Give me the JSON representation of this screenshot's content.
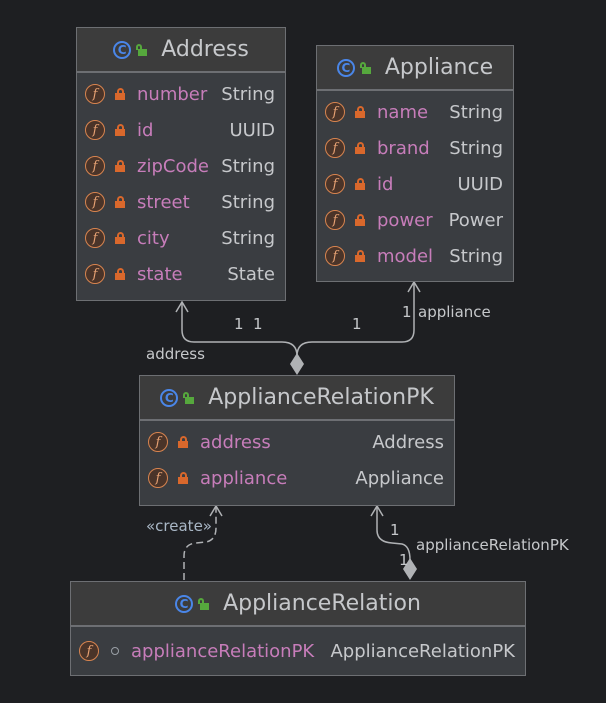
{
  "diagram": {
    "colors": {
      "background": "#1e1f22",
      "node_fill": "#3a3d41",
      "node_border": "#6d6f73",
      "class_icon": "#4a86e8",
      "field_icon": "#d8844f",
      "private_lock": "#d9682c",
      "public_lock": "#56a83d",
      "field_name": "#c77dba",
      "text": "#c6c8cb",
      "edge": "#b0b2b5"
    },
    "classes": {
      "address": {
        "name": "Address",
        "icon": "class-icon",
        "visibility": "public",
        "fields": [
          {
            "name": "number",
            "type": "String",
            "visibility": "private"
          },
          {
            "name": "id",
            "type": "UUID",
            "visibility": "private"
          },
          {
            "name": "zipCode",
            "type": "String",
            "visibility": "private"
          },
          {
            "name": "street",
            "type": "String",
            "visibility": "private"
          },
          {
            "name": "city",
            "type": "String",
            "visibility": "private"
          },
          {
            "name": "state",
            "type": "State",
            "visibility": "private"
          }
        ]
      },
      "appliance": {
        "name": "Appliance",
        "icon": "class-icon",
        "visibility": "public",
        "fields": [
          {
            "name": "name",
            "type": "String",
            "visibility": "private"
          },
          {
            "name": "brand",
            "type": "String",
            "visibility": "private"
          },
          {
            "name": "id",
            "type": "UUID",
            "visibility": "private"
          },
          {
            "name": "power",
            "type": "Power",
            "visibility": "private"
          },
          {
            "name": "model",
            "type": "String",
            "visibility": "private"
          }
        ]
      },
      "pk": {
        "name": "ApplianceRelationPK",
        "icon": "class-icon",
        "visibility": "public",
        "fields": [
          {
            "name": "address",
            "type": "Address",
            "visibility": "private"
          },
          {
            "name": "appliance",
            "type": "Appliance",
            "visibility": "private"
          }
        ]
      },
      "relation": {
        "name": "ApplianceRelation",
        "icon": "class-icon",
        "visibility": "public",
        "fields": [
          {
            "name": "applianceRelationPK",
            "type": "ApplianceRelationPK",
            "visibility": "package-private"
          }
        ]
      }
    },
    "edges": [
      {
        "from": "ApplianceRelationPK",
        "to": "Address",
        "kind": "composition",
        "role": "address",
        "multiplicities": [
          "1",
          "1"
        ]
      },
      {
        "from": "ApplianceRelationPK",
        "to": "Appliance",
        "kind": "composition",
        "role": "appliance",
        "multiplicities": [
          "1",
          "1"
        ]
      },
      {
        "from": "ApplianceRelation",
        "to": "ApplianceRelationPK",
        "kind": "dependency",
        "stereotype": "«create»"
      },
      {
        "from": "ApplianceRelation",
        "to": "ApplianceRelationPK",
        "kind": "composition",
        "role": "applianceRelationPK",
        "multiplicities": [
          "1",
          "1"
        ]
      }
    ],
    "labels": {
      "address_role": "address",
      "address_mult_a": "1",
      "address_mult_b": "1",
      "appliance_role": "appliance",
      "appliance_mult_a": "1",
      "appliance_mult_b": "1",
      "create_stereotype": "«create»",
      "pk_role": "applianceRelationPK",
      "pk_mult_a": "1",
      "pk_mult_b": "1"
    }
  }
}
